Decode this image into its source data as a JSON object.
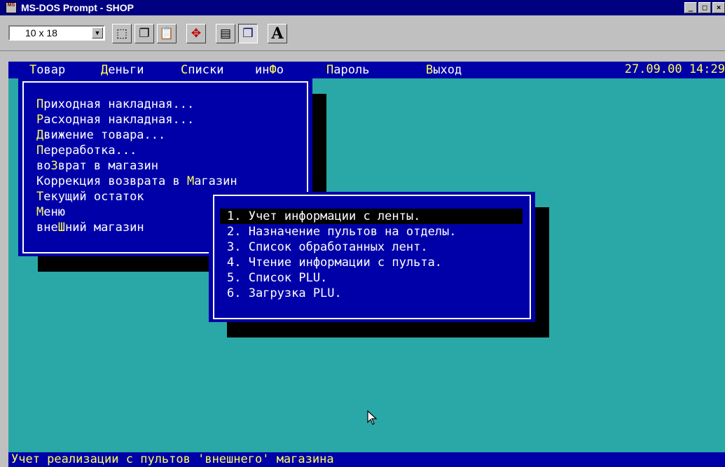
{
  "window": {
    "title": "MS-DOS Prompt - SHOP",
    "icon_text": "MS"
  },
  "toolbar": {
    "font_size": "10 x 18"
  },
  "menubar": {
    "items": [
      {
        "hk": "Т",
        "rest": "овар"
      },
      {
        "hk": "Д",
        "rest": "еньги"
      },
      {
        "hk": "С",
        "rest": "писки"
      },
      {
        "pre": "ин",
        "hk": "Ф",
        "rest": "о"
      },
      {
        "hk": "П",
        "rest": "ароль"
      },
      {
        "hk": "В",
        "rest": "ыход"
      }
    ],
    "clock": "27.09.00 14:29"
  },
  "tovar_menu": {
    "items": [
      {
        "pre": "",
        "hk": "П",
        "rest": "риходная накладная..."
      },
      {
        "pre": "",
        "hk": "Р",
        "rest": "асходная накладная..."
      },
      {
        "pre": "",
        "hk": "Д",
        "rest": "вижение товара..."
      },
      {
        "pre": "",
        "hk": "П",
        "rest": "ереработка..."
      },
      {
        "pre": "во",
        "hk": "З",
        "rest": "врат в магазин"
      },
      {
        "pre": "Коррекция возврата в ",
        "hk": "М",
        "rest": "агазин"
      },
      {
        "pre": "",
        "hk": "Т",
        "rest": "екущий остаток"
      },
      {
        "pre": "",
        "hk": "М",
        "rest": "еню"
      },
      {
        "pre": "вне",
        "hk": "Ш",
        "rest": "ний магазин"
      }
    ]
  },
  "submenu": {
    "items": [
      "1. Учет информации с ленты.",
      "2. Назначение пультов на отделы.",
      "3. Список обработанных лент.",
      "4. Чтение информации с пульта.",
      "5. Список PLU.",
      "6. Загрузка PLU."
    ],
    "selected_index": 0
  },
  "status_text": "Учет реализации с пультов 'внешнего' магазина"
}
